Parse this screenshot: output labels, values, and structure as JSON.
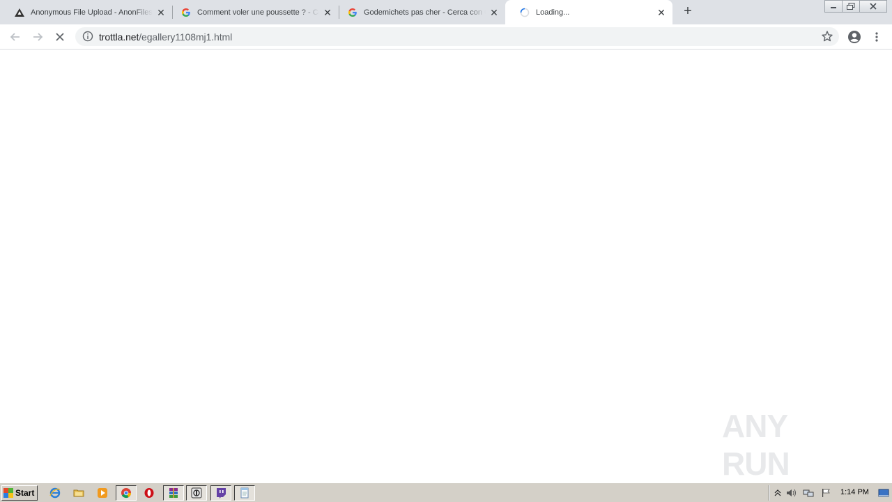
{
  "browser": {
    "tabs": [
      {
        "title": "Anonymous File Upload - AnonFiles",
        "favicon": "anonfiles-icon",
        "active": false
      },
      {
        "title": "Comment voler une poussette ? - Cerca con Google",
        "favicon": "google-icon",
        "active": false
      },
      {
        "title": "Godemichets pas cher - Cerca con Google",
        "favicon": "google-icon",
        "active": false
      },
      {
        "title": "Loading...",
        "favicon": "loading-spinner-icon",
        "active": true
      }
    ],
    "address_bar": {
      "host": "trottla.net",
      "path": "/egallery1108mj1.html"
    },
    "loading": true
  },
  "watermark": {
    "text": "ANY RUN"
  },
  "taskbar": {
    "start_label": "Start",
    "clock": "1:14 PM",
    "quicklaunch": [
      "ie-icon",
      "explorer-icon",
      "media-player-icon",
      "chrome-icon",
      "opera-icon",
      "winrar-icon",
      "filezilla-icon",
      "twitch-icon",
      "notepad-icon"
    ]
  },
  "colors": {
    "tabstrip": "#dee1e6",
    "omnibox": "#f1f3f4",
    "taskbar": "#d4d0c8",
    "accent_blue": "#1a73e8"
  }
}
